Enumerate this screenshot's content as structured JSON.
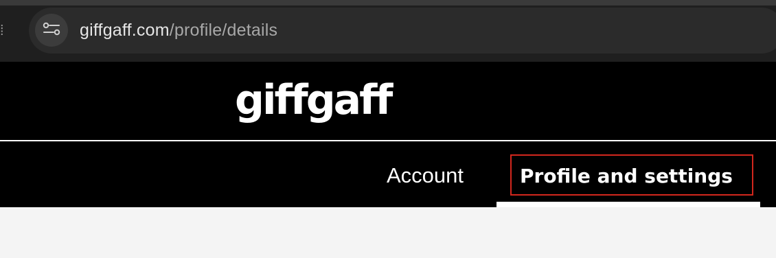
{
  "browser": {
    "url_host": "giffgaff.com",
    "url_path": "/profile/details",
    "site_info_icon": "tune-icon"
  },
  "site": {
    "logo_text": "giffgaff",
    "nav": {
      "account_label": "Account",
      "profile_label": "Profile and settings"
    }
  },
  "colors": {
    "header_bg": "#000000",
    "highlight_border": "#d3271d",
    "content_bg": "#f4f4f4"
  }
}
